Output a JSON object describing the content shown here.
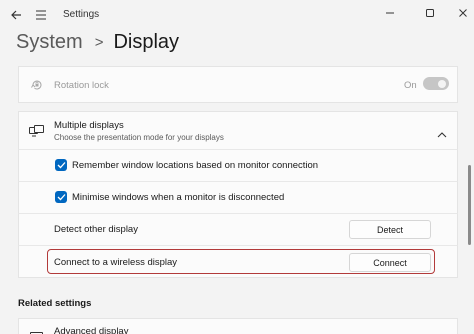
{
  "window": {
    "app_title": "Settings"
  },
  "breadcrumb": {
    "parent": "System",
    "separator": ">",
    "current": "Display"
  },
  "rotation_lock": {
    "label": "Rotation lock",
    "toggle_state": "On"
  },
  "multiple_displays": {
    "title": "Multiple displays",
    "subtitle": "Choose the presentation mode for your displays",
    "options": [
      {
        "label": "Remember window locations based on monitor connection",
        "checked": true
      },
      {
        "label": "Minimise windows when a monitor is disconnected",
        "checked": true
      }
    ],
    "detect": {
      "label": "Detect other display",
      "button": "Detect"
    },
    "wireless": {
      "label": "Connect to a wireless display",
      "button": "Connect"
    }
  },
  "related_settings": {
    "header": "Related settings",
    "items": [
      {
        "label": "Advanced display"
      }
    ]
  },
  "colors": {
    "accent": "#0067c0",
    "highlight_border": "#b23a3a"
  }
}
